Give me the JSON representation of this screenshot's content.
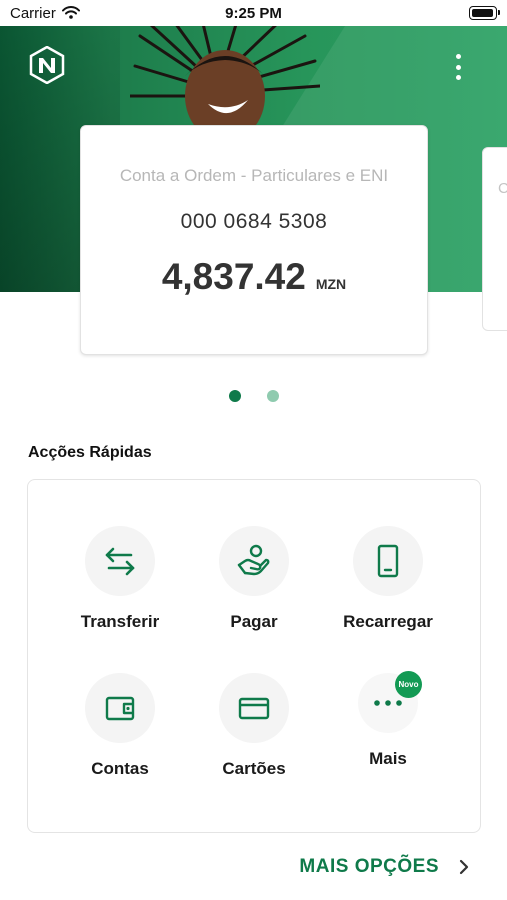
{
  "status_bar": {
    "carrier": "Carrier",
    "time": "9:25 PM"
  },
  "header": {
    "logo_icon": "nedbank-logo-icon",
    "menu_icon": "kebab-menu-icon"
  },
  "account_card": {
    "name": "Conta a Ordem - Particulares e ENI",
    "number": "000 0684 5308",
    "balance": "4,837.42",
    "currency": "MZN"
  },
  "next_card": {
    "name_fragment": "C"
  },
  "carousel": {
    "page_count": 2,
    "active_index": 0
  },
  "quick_actions": {
    "title": "Acções Rápidas",
    "items": [
      {
        "label": "Transferir",
        "icon": "transfer-arrows-icon"
      },
      {
        "label": "Pagar",
        "icon": "hand-pay-icon"
      },
      {
        "label": "Recarregar",
        "icon": "mobile-phone-icon"
      },
      {
        "label": "Contas",
        "icon": "wallet-icon"
      },
      {
        "label": "Cartões",
        "icon": "credit-card-icon"
      },
      {
        "label": "Mais",
        "icon": "more-dots-icon",
        "badge": "Novo"
      }
    ]
  },
  "footer": {
    "more_options": "MAIS OPÇÕES",
    "chevron_icon": "chevron-right-icon"
  },
  "colors": {
    "brand_green": "#0f7a4a",
    "hero_green": "#27955a",
    "badge_green": "#139a54"
  }
}
